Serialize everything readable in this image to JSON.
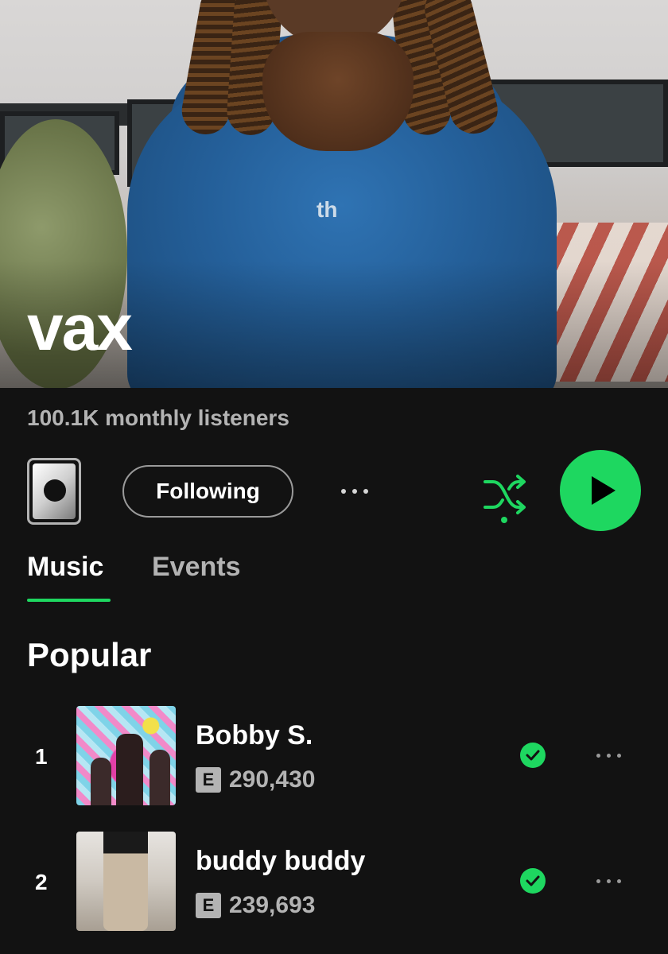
{
  "artist": {
    "name": "vax",
    "monthly_listeners": "100.1K monthly listeners"
  },
  "actions": {
    "follow_label": "Following",
    "shuffle_color": "#1ed760",
    "play_color": "#1ed760"
  },
  "tabs": [
    {
      "label": "Music",
      "active": true
    },
    {
      "label": "Events",
      "active": false
    }
  ],
  "popular": {
    "title": "Popular",
    "tracks": [
      {
        "rank": "1",
        "title": "Bobby S.",
        "explicit": "E",
        "plays": "290,430",
        "saved": true
      },
      {
        "rank": "2",
        "title": "buddy buddy",
        "explicit": "E",
        "plays": "239,693",
        "saved": true
      }
    ]
  },
  "icons": [
    "artist-thumbnail",
    "more-options-icon",
    "shuffle-icon",
    "play-icon",
    "explicit-badge",
    "saved-check-icon",
    "track-more-icon"
  ]
}
